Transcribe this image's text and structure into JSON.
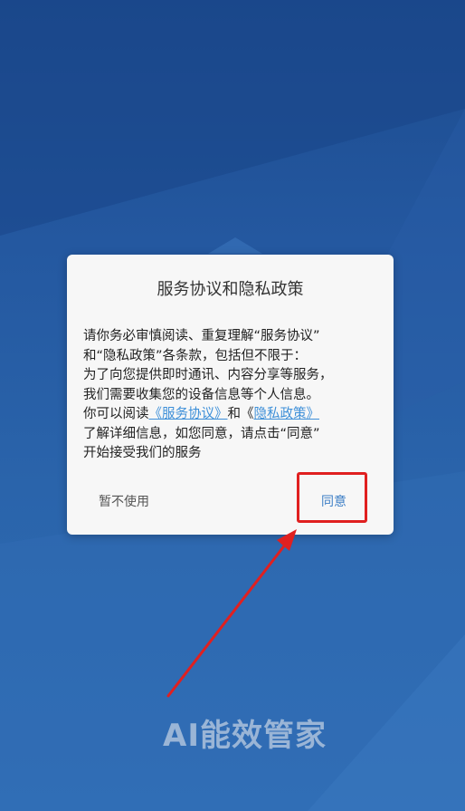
{
  "dialog": {
    "title": "服务协议和隐私政策",
    "body": {
      "line1": "请你务必审慎阅读、重复理解“服务协议”",
      "line2": "和“隐私政策”各条款，包括但不限于：",
      "line3": "为了向您提供即时通讯、内容分享等服务，",
      "line4": "我们需要收集您的设备信息等个人信息。",
      "line5_prefix": "你可以阅读",
      "service_link": "《服务协议》",
      "line5_and": "和《",
      "privacy_link": "隐私政策》",
      "line6": "了解详细信息，如您同意，请点击“同意”",
      "line7": "开始接受我们的服务"
    },
    "decline_label": "暂不使用",
    "agree_label": "同意"
  },
  "watermark": "AI能效管家",
  "colors": {
    "background": "#2458a0",
    "link": "#3d8fd8",
    "agree": "#3d7fc6",
    "highlight": "#e02020"
  }
}
